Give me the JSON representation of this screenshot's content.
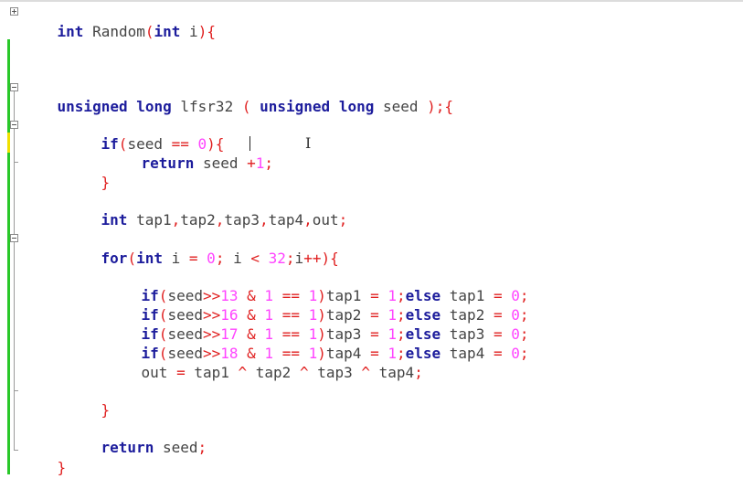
{
  "editor": {
    "lines": {
      "l1": [
        "int",
        " Random",
        "(",
        "int",
        " i",
        ")",
        "{"
      ],
      "l2": [
        "unsigned",
        " ",
        "long",
        " lfsr32 ",
        "(",
        " ",
        "unsigned",
        " ",
        "long",
        " seed ",
        ");{"
      ],
      "l3": [
        "if",
        "(",
        "seed ",
        "==",
        " ",
        "0",
        "){"
      ],
      "l4": [
        "return",
        " seed ",
        "+",
        "1",
        ";"
      ],
      "l5": [
        "}"
      ],
      "l6": [
        "int",
        " tap1",
        ",",
        "tap2",
        ",",
        "tap3",
        ",",
        "tap4",
        ",",
        "out",
        ";"
      ],
      "l7": [
        "for",
        "(",
        "int",
        " i ",
        "=",
        " ",
        "0",
        ";",
        " i ",
        "<",
        " ",
        "32",
        ";",
        "i",
        "++",
        "){"
      ],
      "l8": [
        "if",
        "(",
        "seed",
        ">>",
        "13",
        " ",
        "&",
        " ",
        "1",
        " ",
        "==",
        " ",
        "1",
        ")",
        "tap1 ",
        "=",
        " ",
        "1",
        ";",
        "else",
        " tap1 ",
        "=",
        " ",
        "0",
        ";"
      ],
      "l9": [
        "if",
        "(",
        "seed",
        ">>",
        "16",
        " ",
        "&",
        " ",
        "1",
        " ",
        "==",
        " ",
        "1",
        ")",
        "tap2 ",
        "=",
        " ",
        "1",
        ";",
        "else",
        " tap2 ",
        "=",
        " ",
        "0",
        ";"
      ],
      "l10": [
        "if",
        "(",
        "seed",
        ">>",
        "17",
        " ",
        "&",
        " ",
        "1",
        " ",
        "==",
        " ",
        "1",
        ")",
        "tap3 ",
        "=",
        " ",
        "1",
        ";",
        "else",
        " tap3 ",
        "=",
        " ",
        "0",
        ";"
      ],
      "l11": [
        "if",
        "(",
        "seed",
        ">>",
        "18",
        " ",
        "&",
        " ",
        "1",
        " ",
        "==",
        " ",
        "1",
        ")",
        "tap4 ",
        "=",
        " ",
        "1",
        ";",
        "else",
        " tap4 ",
        "=",
        " ",
        "0",
        ";"
      ],
      "l12": [
        "out ",
        "=",
        " tap1 ",
        "^",
        " tap2 ",
        "^",
        " tap3 ",
        "^",
        " tap4",
        ";"
      ],
      "l13": [
        "}"
      ],
      "l14": [
        "return",
        " seed",
        ";"
      ],
      "l15": [
        "}"
      ]
    },
    "colors": {
      "keyword": "#1c1c9c",
      "punctuation": "#e01f1f",
      "number": "#ff44ff",
      "text": "#444444",
      "changed_saved": "#29c829",
      "changed_unsaved": "#f0e000",
      "current_line": "#e5e5e5"
    },
    "cursor_icon": "text-ibeam-icon"
  }
}
